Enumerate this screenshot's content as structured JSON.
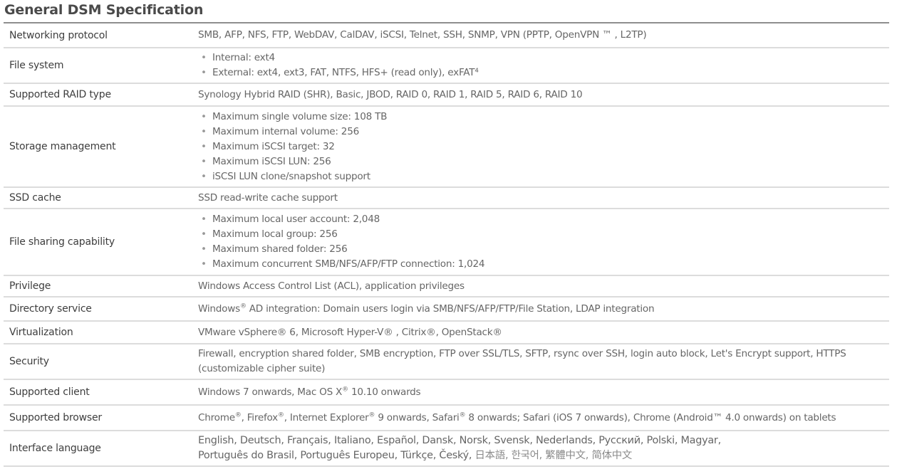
{
  "page": {
    "title": "General DSM Specification"
  },
  "rows": [
    {
      "label": "Networking protocol",
      "text": "SMB, AFP, NFS, FTP, WebDAV, CalDAV, iSCSI, Telnet, SSH, SNMP, VPN (PPTP, OpenVPN ™ , L2TP)"
    },
    {
      "label": "File system",
      "items": [
        "Internal: ext4",
        "External: ext4, ext3, FAT, NTFS, HFS+ (read only), exFAT⁴"
      ]
    },
    {
      "label": "Supported RAID type",
      "text": "Synology Hybrid RAID (SHR), Basic, JBOD, RAID 0, RAID 1, RAID 5, RAID 6, RAID 10"
    },
    {
      "label": "Storage management",
      "items": [
        "Maximum single volume size: 108 TB",
        "Maximum internal volume: 256",
        "Maximum iSCSI target: 32",
        "Maximum iSCSI LUN: 256",
        "iSCSI LUN clone/snapshot support"
      ]
    },
    {
      "label": "SSD cache",
      "text": "SSD read-write cache support"
    },
    {
      "label": "File sharing capability",
      "items": [
        "Maximum local user account: 2,048",
        "Maximum local group: 256",
        "Maximum shared folder: 256",
        "Maximum concurrent SMB/NFS/AFP/FTP connection: 1,024"
      ]
    },
    {
      "label": "Privilege",
      "text": "Windows Access Control List (ACL), application privileges"
    },
    {
      "label": "Directory service",
      "text_pre": "Windows",
      "sup": "®",
      "text_post": " AD integration: Domain users login via SMB/NFS/AFP/FTP/File Station, LDAP integration"
    },
    {
      "label": "Virtualization",
      "text": "VMware vSphere® 6, Microsoft Hyper-V® , Citrix®, OpenStack®"
    },
    {
      "label": "Security",
      "lines": [
        "Firewall, encryption shared folder, SMB encryption, FTP over SSL/TLS, SFTP, rsync over SSH, login auto block, Let's Encrypt support, HTTPS",
        "(customizable cipher suite)"
      ]
    },
    {
      "label": "Supported client",
      "text_pre": "Windows 7 onwards, Mac OS X",
      "sup": "®",
      "text_post": " 10.10 onwards"
    },
    {
      "label": "Supported browser",
      "parts": [
        {
          "t": "Chrome"
        },
        {
          "sup": "®"
        },
        {
          "t": ", Firefox"
        },
        {
          "sup": "®"
        },
        {
          "t": ", Internet Explorer"
        },
        {
          "sup": "®"
        },
        {
          "t": " 9 onwards, Safari"
        },
        {
          "sup": "®"
        },
        {
          "t": " 8 onwards; Safari (iOS 7 onwards), Chrome (Android™ 4.0 onwards) on tablets"
        }
      ]
    },
    {
      "label": "Interface language",
      "lines": [
        "English, Deutsch, Français, Italiano, Español, Dansk, Norsk, Svensk, Nederlands, Русский, Polski, Magyar,",
        "Português do Brasil, Português Europeu, Türkçe, Český,"
      ],
      "cjk": " 日本語, 한국어, 繁體中文, 简体中文"
    }
  ]
}
